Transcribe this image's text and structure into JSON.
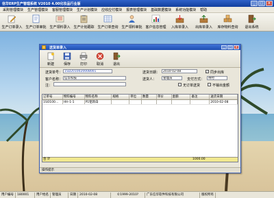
{
  "app": {
    "title": "信华ERP生产管理系统 V2010 4.00化妆品行业版",
    "window_controls": [
      "_",
      "□",
      "×"
    ]
  },
  "menu": [
    "采购管理模块",
    "生产管理模块",
    "客服管理模块",
    "生产计划模块",
    "应收应付模块",
    "报表管理模块",
    "基础数据模块",
    "系统功能模块",
    "帮助"
  ],
  "toolbar": [
    {
      "label": "生产订单录入",
      "icon": "pencil-icon"
    },
    {
      "label": "生产订单审批",
      "icon": "document-icon"
    },
    {
      "label": "生产领料录入",
      "icon": "list-icon"
    },
    {
      "label": "生产计划跟踪",
      "icon": "clipboard-icon"
    },
    {
      "label": "生产订单查询",
      "icon": "grid-icon"
    },
    {
      "label": "生产领料审批",
      "icon": "person-icon"
    },
    {
      "label": "客户信息管理",
      "icon": "chart-icon"
    },
    {
      "label": "入库单录入",
      "icon": "download-icon"
    },
    {
      "label": "出库单录入",
      "icon": "upload-icon"
    },
    {
      "label": "库存物料查询",
      "icon": "boxes-icon"
    },
    {
      "label": "退出系统",
      "icon": "exit-icon"
    }
  ],
  "dialog": {
    "title": "送货单录入",
    "toolbar": [
      {
        "label": "新建",
        "icon": "new-doc-icon"
      },
      {
        "label": "保存",
        "icon": "save-icon"
      },
      {
        "label": "打印",
        "icon": "print-icon"
      },
      {
        "label": "取消",
        "icon": "cancel-icon"
      },
      {
        "label": "退出",
        "icon": "exit-icon"
      }
    ],
    "form": {
      "order_no_label": "送货单号：",
      "order_no_value": "1SD2010020008001",
      "date_label": "送货日期：",
      "date_value": "2010-02-08",
      "sync_label": "同步出库",
      "customer_label": "客户名称：",
      "customer_value": "信华科技",
      "entry_label": "送货人：",
      "entry_value": "管理员",
      "payment_label": "支付方式：",
      "payment_value": "待付",
      "note_label": "注：",
      "no_invoice_label": "无订单送货",
      "no_stock_label": "不输出金额"
    },
    "grid": {
      "columns": [
        "订单号",
        "物料编号",
        "物料名称",
        "规格",
        "单位",
        "数量",
        "单价",
        "金额",
        "备注",
        "送货日期"
      ],
      "rows": [
        [
          "1SO100…",
          "HH-1-1",
          "P1铝饰白",
          "",
          "",
          "",
          "",
          "",
          "",
          "2010-02-08"
        ]
      ],
      "footer_label": "合  计",
      "footer_total": "1000.00"
    },
    "status": "操作提示"
  },
  "statusbar": {
    "user_id_label": "用户编号",
    "user_id_value": "180001",
    "user_name_label": "用户姓名",
    "user_name_value": "管理员",
    "date_label": "日期",
    "date_value": "2010-02-08",
    "copyright": "©1999-2010?",
    "company": "广东信华软件科技有限公司",
    "rights": "版权所有"
  },
  "colors": {
    "title_blue": "#1f4fb1",
    "grid_total_bg": "#f1e88f",
    "link_blue": "#1e3faf"
  }
}
